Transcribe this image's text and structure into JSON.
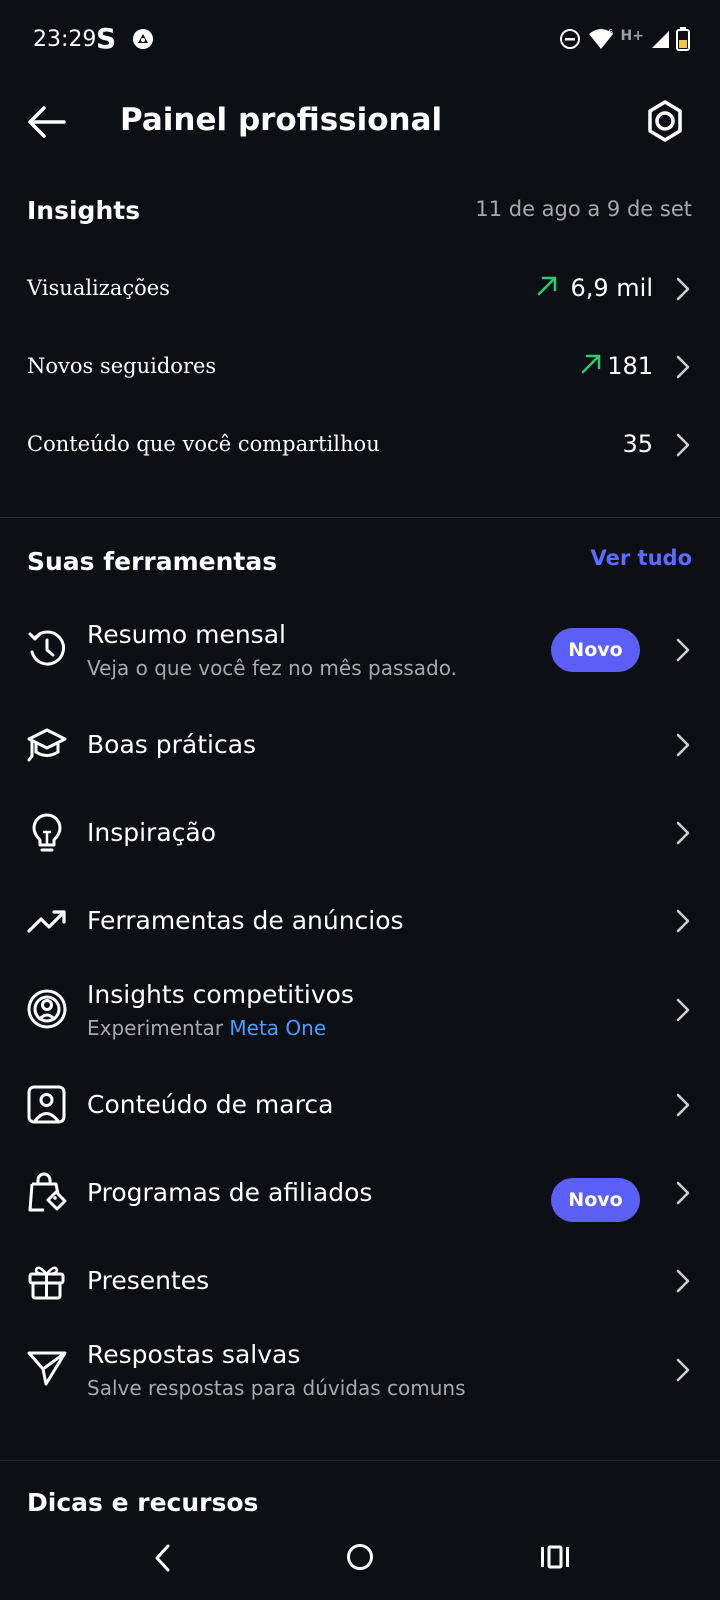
{
  "status_bar": {
    "time": "23:29",
    "app_letter": "S",
    "network_label": "H+",
    "icons": [
      "s-app-icon",
      "notification-icon",
      "dnd-icon",
      "wifi-icon",
      "mobile-signal-icon",
      "battery-icon"
    ]
  },
  "header": {
    "title": "Painel profissional",
    "back_icon": "arrow-left-icon",
    "settings_icon": "gear-icon"
  },
  "insights": {
    "title": "Insights",
    "date_range": "11 de ago a 9 de set",
    "metrics": [
      {
        "label": "Visualizações",
        "value": "6,9 mil",
        "trend": "up"
      },
      {
        "label": "Novos seguidores",
        "value": "181",
        "trend": "up"
      },
      {
        "label": "Conteúdo que você compartilhou",
        "value": "35",
        "trend": ""
      }
    ]
  },
  "tools": {
    "title": "Suas ferramentas",
    "see_all": "Ver tudo",
    "items": [
      {
        "label": "Resumo mensal",
        "subtitle": "Veja o que você fez no mês passado.",
        "badge": "Novo",
        "icon": "history-clock-icon"
      },
      {
        "label": "Boas práticas",
        "icon": "graduation-cap-icon"
      },
      {
        "label": "Inspiração",
        "icon": "lightbulb-icon"
      },
      {
        "label": "Ferramentas de anúncios",
        "icon": "trending-up-icon"
      },
      {
        "label": "Insights competitivos",
        "subtitle": "Experimentar",
        "subtitle_link": "Meta One",
        "icon": "target-person-icon"
      },
      {
        "label": "Conteúdo de marca",
        "icon": "branded-content-icon"
      },
      {
        "label": "Programas de afiliados",
        "badge": "Novo",
        "icon": "shopping-bag-tag-icon"
      },
      {
        "label": "Presentes",
        "icon": "gift-icon"
      },
      {
        "label": "Respostas salvas",
        "subtitle": "Salve respostas para dúvidas comuns",
        "icon": "paper-plane-icon"
      }
    ]
  },
  "tips": {
    "title": "Dicas e recursos"
  },
  "nav_bar": {
    "icons": [
      "back-nav-icon",
      "home-nav-icon",
      "recents-nav-icon"
    ]
  },
  "colors": {
    "background": "#0c1014",
    "accent": "#5b5ff5",
    "link": "#4a9cff",
    "trend_up": "#2ecc71"
  }
}
